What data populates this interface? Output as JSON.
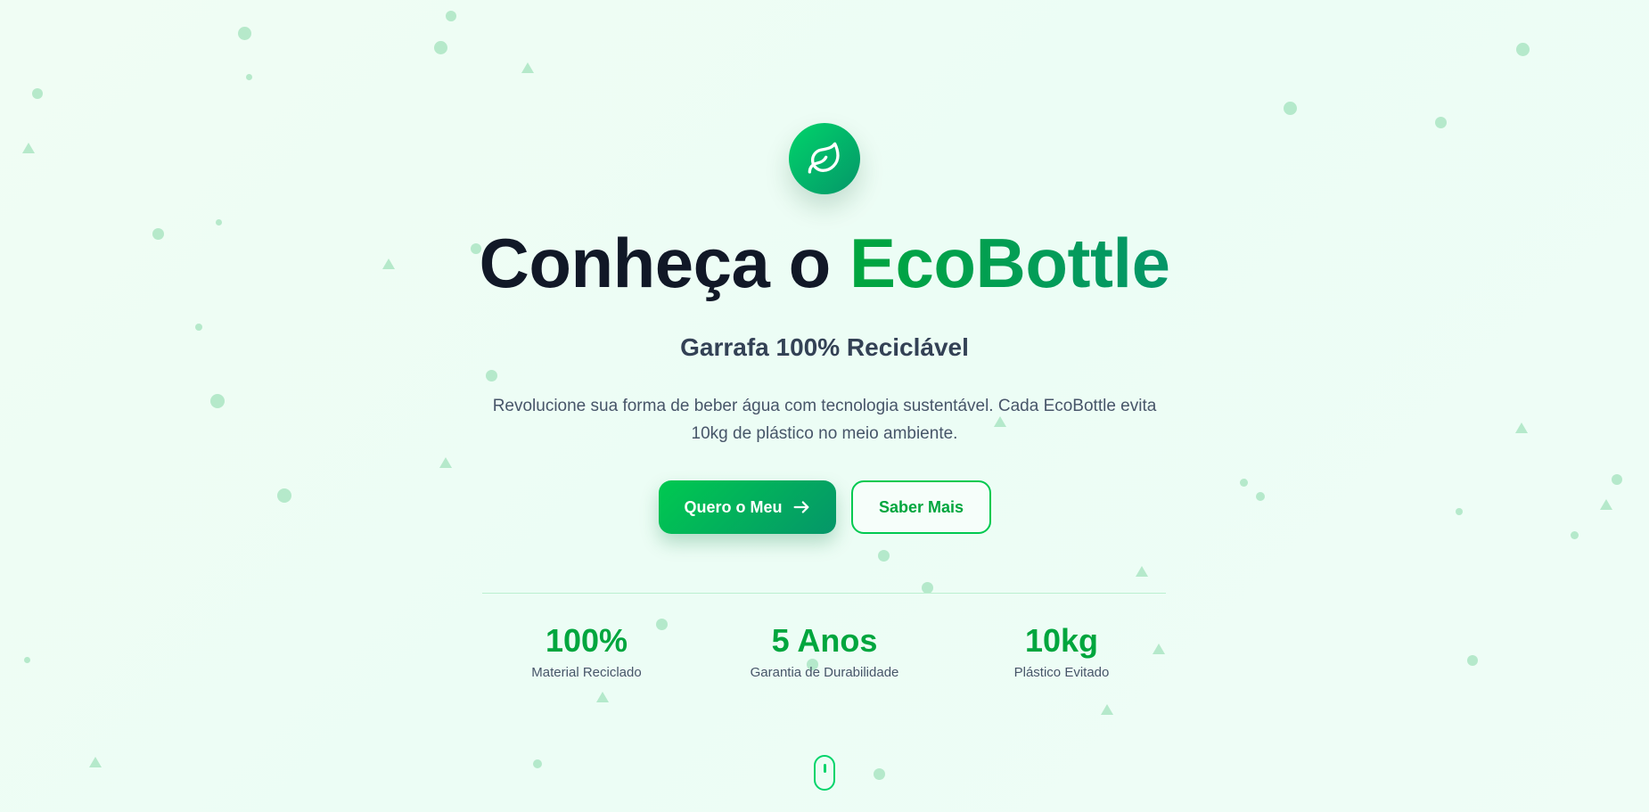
{
  "hero": {
    "icon": "leaf-icon",
    "title_prefix": "Conheça o",
    "title_highlight": "EcoBottle",
    "subtitle": "Garrafa 100% Reciclável",
    "description": "Revolucione sua forma de beber água com tecnologia sustentável. Cada EcoBottle evita 10kg de plástico no meio ambiente.",
    "primary_button": "Quero o Meu",
    "primary_button_icon": "arrow-right-icon",
    "secondary_button": "Saber Mais"
  },
  "stats": [
    {
      "value": "100%",
      "label": "Material Reciclado"
    },
    {
      "value": "5 Anos",
      "label": "Garantia de Durabilidade"
    },
    {
      "value": "10kg",
      "label": "Plástico Evitado"
    }
  ],
  "scroll_indicator": "mouse-scroll-icon",
  "colors": {
    "accent": "#00a63e",
    "accent_dark": "#059669",
    "text": "#111827",
    "background": "#ecfdf5"
  }
}
